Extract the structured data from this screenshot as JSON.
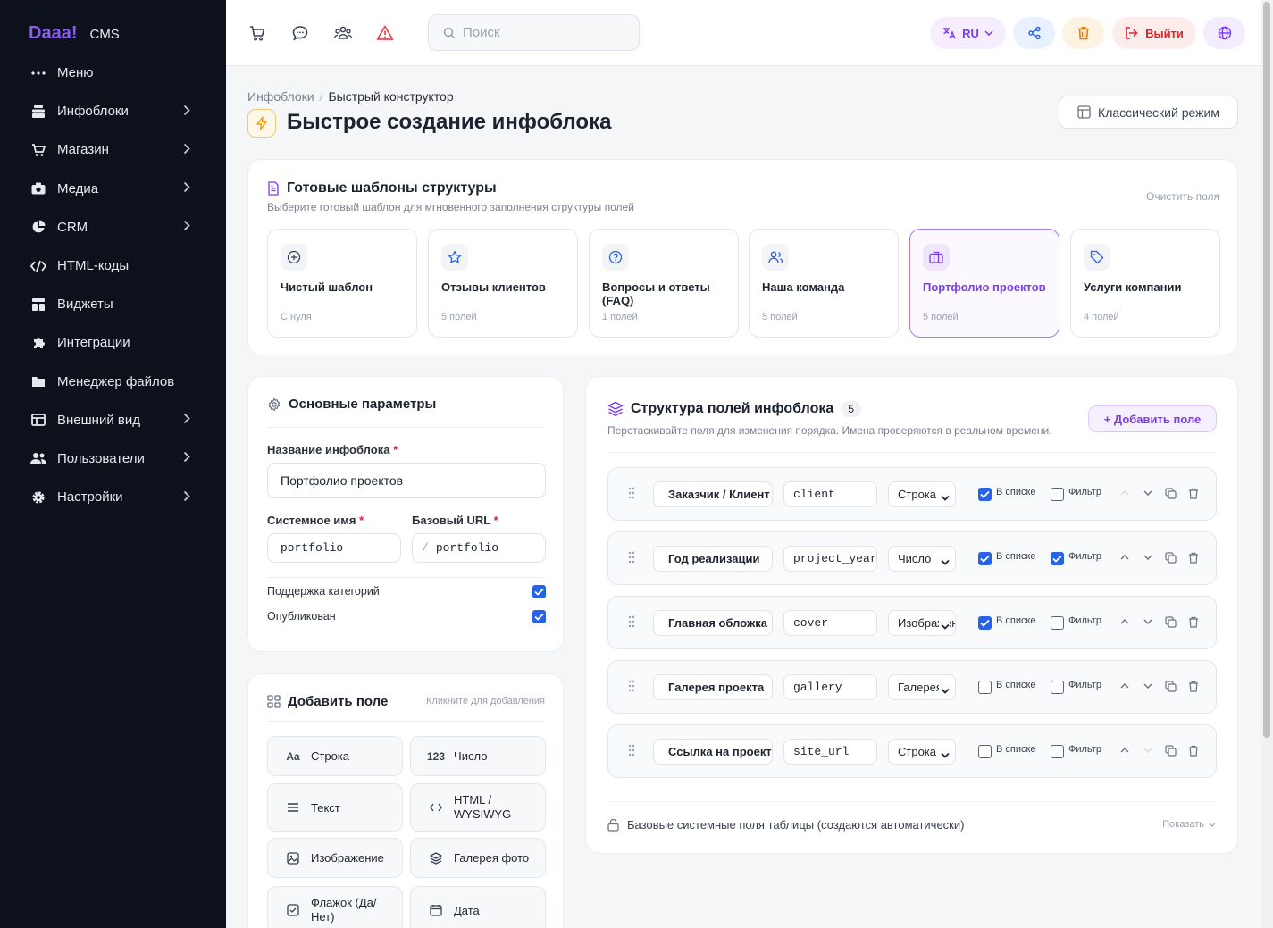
{
  "sidebar": {
    "brand": "Daaa!",
    "cms": "CMS",
    "items": [
      {
        "label": "Меню",
        "icon": "dots-icon",
        "chevron": false
      },
      {
        "label": "Инфоблоки",
        "icon": "layers-icon",
        "chevron": true
      },
      {
        "label": "Магазин",
        "icon": "cart-icon",
        "chevron": true
      },
      {
        "label": "Медиа",
        "icon": "camera-icon",
        "chevron": true
      },
      {
        "label": "CRM",
        "icon": "pie-icon",
        "chevron": true
      },
      {
        "label": "HTML-коды",
        "icon": "code-icon",
        "chevron": false
      },
      {
        "label": "Виджеты",
        "icon": "widget-icon",
        "chevron": false
      },
      {
        "label": "Интеграции",
        "icon": "puzzle-icon",
        "chevron": false
      },
      {
        "label": "Менеджер файлов",
        "icon": "folder-icon",
        "chevron": false
      },
      {
        "label": "Внешний вид",
        "icon": "layout-icon",
        "chevron": true
      },
      {
        "label": "Пользователи",
        "icon": "users-icon",
        "chevron": true
      },
      {
        "label": "Настройки",
        "icon": "gear-icon",
        "chevron": true
      }
    ]
  },
  "topbar": {
    "search_placeholder": "Поиск",
    "lang": "RU",
    "logout": "Выйти"
  },
  "breadcrumb": {
    "parent": "Инфоблоки",
    "separator": "/",
    "current": "Быстрый конструктор"
  },
  "page_title": "Быстрое создание инфоблока",
  "classic_mode": "Классический режим",
  "templates": {
    "title": "Готовые шаблоны структуры",
    "subtitle": "Выберите готовый шаблон для мгновенного заполнения структуры полей",
    "clear": "Очистить поля",
    "items": [
      {
        "name": "Чистый шаблон",
        "count": "С нуля",
        "icon": "plus-circle-icon",
        "selected": false
      },
      {
        "name": "Отзывы клиентов",
        "count": "5 полей",
        "icon": "star-icon",
        "selected": false
      },
      {
        "name": "Вопросы и ответы (FAQ)",
        "count": "1 полей",
        "icon": "question-icon",
        "selected": false
      },
      {
        "name": "Наша команда",
        "count": "5 полей",
        "icon": "team-icon",
        "selected": false
      },
      {
        "name": "Портфолио проектов",
        "count": "5 полей",
        "icon": "briefcase-icon",
        "selected": true
      },
      {
        "name": "Услуги компании",
        "count": "4 полей",
        "icon": "tag-icon",
        "selected": false
      }
    ]
  },
  "params": {
    "title": "Основные параметры",
    "name_label": "Название инфоблока",
    "name_value": "Портфолио проектов",
    "sys_label": "Системное имя",
    "sys_value": "portfolio",
    "url_label": "Базовый URL",
    "url_prefix": "/",
    "url_value": "portfolio",
    "req": "*",
    "categories_label": "Поддержка категорий",
    "categories": true,
    "published_label": "Опубликован",
    "published": true
  },
  "add_field": {
    "title": "Добавить поле",
    "hint": "Кликните для добавления",
    "types": [
      {
        "label": "Строка",
        "icon": "Aa"
      },
      {
        "label": "Число",
        "icon": "123"
      },
      {
        "label": "Текст",
        "icon": "text-lines-icon"
      },
      {
        "label": "HTML / WYSIWYG",
        "icon": "code-brackets-icon"
      },
      {
        "label": "Изображение",
        "icon": "image-icon"
      },
      {
        "label": "Галерея фото",
        "icon": "stack-icon"
      },
      {
        "label": "Флажок (Да/Нет)",
        "icon": "checkbox-icon"
      },
      {
        "label": "Дата",
        "icon": "calendar-icon"
      }
    ]
  },
  "structure": {
    "title": "Структура полей инфоблока",
    "count": "5",
    "subtitle": "Перетаскивайте поля для изменения порядка. Имена проверяются в реальном времени.",
    "add_button": "+ Добавить поле",
    "in_list_label": "В списке",
    "filter_label": "Фильтр",
    "rows": [
      {
        "name": "Заказчик / Клиент",
        "code": "client",
        "type": "Строка",
        "in_list": true,
        "filter": false
      },
      {
        "name": "Год реализации",
        "code": "project_year",
        "type": "Число",
        "in_list": true,
        "filter": true
      },
      {
        "name": "Главная обложка",
        "code": "cover",
        "type": "Изображение",
        "in_list": true,
        "filter": false
      },
      {
        "name": "Галерея проекта",
        "code": "gallery",
        "type": "Галерея",
        "in_list": false,
        "filter": false
      },
      {
        "name": "Ссылка на проект",
        "code": "site_url",
        "type": "Строка",
        "in_list": false,
        "filter": false
      }
    ],
    "base_fields": "Базовые системные поля таблицы (создаются автоматически)",
    "show": "Показать"
  },
  "colors": {
    "accent": "#7c3aed",
    "checkbox": "#2563eb",
    "sidebar": "#0c111c",
    "danger": "#dc2626"
  }
}
